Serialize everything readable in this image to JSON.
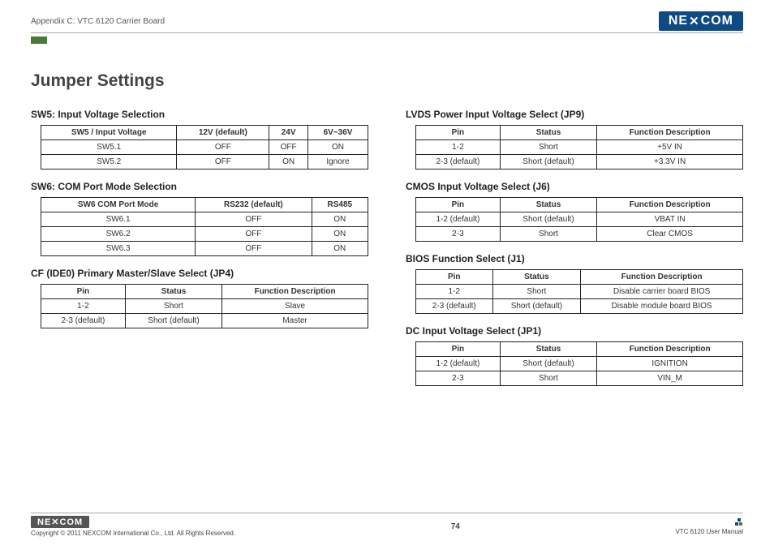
{
  "header": {
    "breadcrumb": "Appendix C: VTC 6120 Carrier Board",
    "logo": "NEXCOM"
  },
  "title": "Jumper Settings",
  "left": {
    "sw5": {
      "title": "SW5: Input Voltage Selection",
      "hdr": [
        "SW5 / Input Voltage",
        "12V (default)",
        "24V",
        "6V~36V"
      ],
      "rows": [
        [
          "SW5.1",
          "OFF",
          "OFF",
          "ON"
        ],
        [
          "SW5.2",
          "OFF",
          "ON",
          "Ignore"
        ]
      ]
    },
    "sw6": {
      "title": "SW6: COM Port Mode Selection",
      "hdr": [
        "SW6 COM Port Mode",
        "RS232 (default)",
        "RS485"
      ],
      "rows": [
        [
          "SW6.1",
          "OFF",
          "ON"
        ],
        [
          "SW6.2",
          "OFF",
          "ON"
        ],
        [
          "SW6.3",
          "OFF",
          "ON"
        ]
      ]
    },
    "jp4": {
      "title": "CF (IDE0) Primary Master/Slave Select (JP4)",
      "hdr": [
        "Pin",
        "Status",
        "Function Description"
      ],
      "rows": [
        [
          "1-2",
          "Short",
          "Slave"
        ],
        [
          "2-3 (default)",
          "Short (default)",
          "Master"
        ]
      ]
    }
  },
  "right": {
    "jp9": {
      "title": "LVDS Power Input Voltage Select (JP9)",
      "hdr": [
        "Pin",
        "Status",
        "Function Description"
      ],
      "rows": [
        [
          "1-2",
          "Short",
          "+5V IN"
        ],
        [
          "2-3 (default)",
          "Short (default)",
          "+3.3V IN"
        ]
      ]
    },
    "j6": {
      "title": "CMOS Input Voltage Select (J6)",
      "hdr": [
        "Pin",
        "Status",
        "Function Description"
      ],
      "rows": [
        [
          "1-2 (default)",
          "Short (default)",
          "VBAT IN"
        ],
        [
          "2-3",
          "Short",
          "Clear CMOS"
        ]
      ]
    },
    "j1": {
      "title": "BIOS Function Select (J1)",
      "hdr": [
        "Pin",
        "Status",
        "Function Description"
      ],
      "rows": [
        [
          "1-2",
          "Short",
          "Disable carrier board BIOS"
        ],
        [
          "2-3 (default)",
          "Short (default)",
          "Disable module board BIOS"
        ]
      ]
    },
    "jp1": {
      "title": "DC Input Voltage Select (JP1)",
      "hdr": [
        "Pin",
        "Status",
        "Function Description"
      ],
      "rows": [
        [
          "1-2 (default)",
          "Short (default)",
          "IGNITION"
        ],
        [
          "2-3",
          "Short",
          "VIN_M"
        ]
      ]
    }
  },
  "footer": {
    "logo": "NEXCOM",
    "copyright": "Copyright © 2011 NEXCOM International Co., Ltd. All Rights Reserved.",
    "page": "74",
    "manual": "VTC 6120 User Manual"
  }
}
